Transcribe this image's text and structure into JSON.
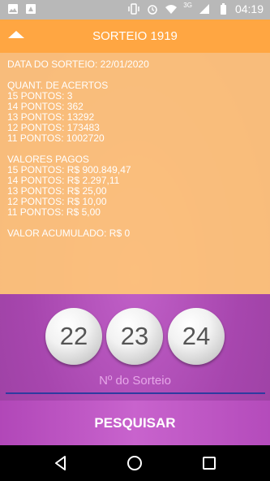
{
  "status_bar": {
    "time": "04:19",
    "network": "3G",
    "left_icons": [
      "image-icon",
      "sync-icon"
    ],
    "right_icons": [
      "vibrate-icon",
      "alarm-icon",
      "wifi-icon",
      "signal-icon",
      "battery-icon"
    ]
  },
  "panel": {
    "title": "SORTEIO 1919",
    "draw_date": "DATA DO SORTEIO: 22/01/2020",
    "hits_header": "QUANT. DE ACERTOS",
    "hits": [
      "15 PONTOS: 3",
      "14 PONTOS: 362",
      "13 PONTOS: 13292",
      "12 PONTOS: 173483",
      "11 PONTOS: 1002720"
    ],
    "paid_header": "VALORES PAGOS",
    "paid": [
      "15 PONTOS: R$ 900.849,47",
      "14 PONTOS: R$ 2.297,11",
      "13 PONTOS: R$ 25,00",
      "12 PONTOS: R$ 10,00",
      "11 PONTOS: R$ 5,00"
    ],
    "accumulated": "VALOR ACUMULADO: R$ 0"
  },
  "balls": [
    "22",
    "23",
    "24"
  ],
  "search": {
    "placeholder": "Nº do Sorteio",
    "button_label": "PESQUISAR"
  },
  "colors": {
    "panel_header": "#ffa642",
    "panel_body": "#ffc677",
    "background": "#a746ae",
    "field_underline": "#2e3ba0"
  }
}
